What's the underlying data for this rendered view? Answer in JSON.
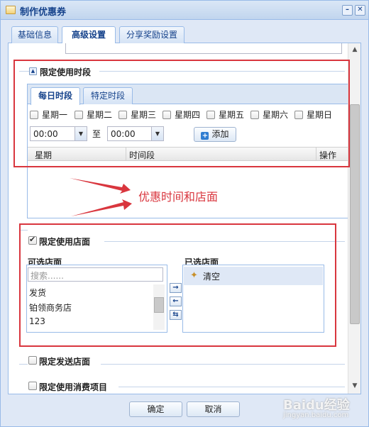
{
  "window": {
    "title": "制作优惠券"
  },
  "tabs": [
    "基础信息",
    "高级设置",
    "分享奖励设置"
  ],
  "section_time": {
    "legend": "限定使用时段",
    "inner_tabs": [
      "每日时段",
      "特定时段"
    ],
    "days": [
      "星期一",
      "星期二",
      "星期三",
      "星期四",
      "星期五",
      "星期六",
      "星期日"
    ],
    "start_time": "00:00",
    "to_label": "至",
    "end_time": "00:00",
    "add_label": "添加",
    "columns": [
      "星期",
      "时间段",
      "操作"
    ]
  },
  "annotation": "优惠时间和店面",
  "section_store": {
    "legend": "限定使用店面",
    "checked": true,
    "available_title": "可选店面",
    "search_placeholder": "搜索......",
    "available_items": [
      "发货",
      "铂领商务店",
      "123"
    ],
    "selected_title": "已选店面",
    "clear_label": "清空"
  },
  "section_send": {
    "legend": "限定发送店面"
  },
  "section_items": {
    "legend": "限定使用消费项目"
  },
  "footer": {
    "ok_label": "确定",
    "cancel_label": "取消"
  },
  "watermark": {
    "brand": "Baidu经验",
    "url": "jingyan.baidu.com"
  },
  "colors": {
    "annotation_red": "#d9363e",
    "border_blue": "#99bbe8",
    "title_blue": "#15428b"
  }
}
